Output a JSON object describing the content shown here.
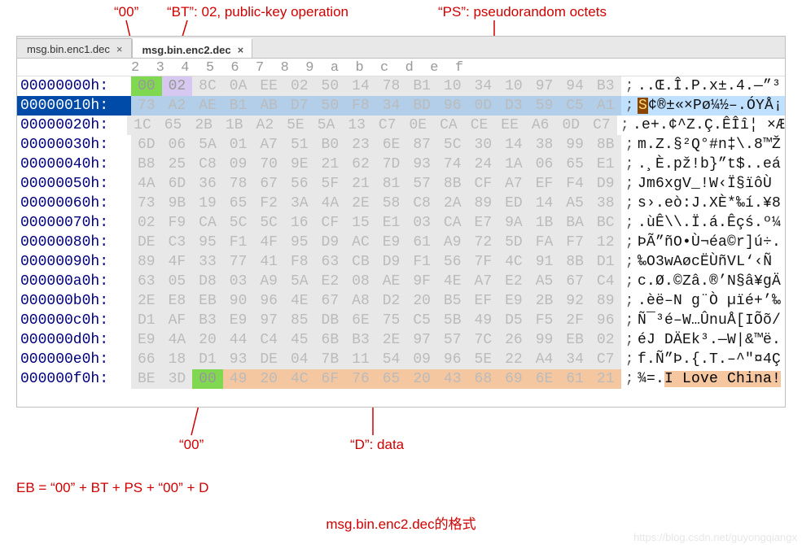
{
  "annotations": {
    "top1": "“00”",
    "top2": "“BT”: 02, public-key operation",
    "top3": "“PS”: pseudorandom octets",
    "bot1": "“00”",
    "bot2": "“D”: data",
    "formula": "EB = “00” + BT + PS + “00” + D",
    "caption": "msg.bin.enc2.dec的格式"
  },
  "tabs": {
    "inactive_label": "msg.bin.enc1.dec",
    "active_label": "msg.bin.enc2.dec",
    "close_glyph": "×"
  },
  "hex": {
    "col_header": "2  3  4  5  6  7  8  9  a  b  c  d  e  f",
    "rows": [
      {
        "off": "00000000h:",
        "bytes": [
          "00",
          "02",
          "8C",
          "0A",
          "EE",
          "02",
          "50",
          "14",
          "78",
          "B1",
          "10",
          "34",
          "10",
          "97",
          "94",
          "B3"
        ],
        "ascii": "..Œ.Î.P.x±.4.—”³",
        "styles": [
          "gr",
          "pu",
          "gy",
          "gy",
          "gy",
          "gy",
          "gy",
          "gy",
          "gy",
          "gy",
          "gy",
          "gy",
          "gy",
          "gy",
          "gy",
          "gy"
        ]
      },
      {
        "off": "00000010h:",
        "sel": true,
        "bytes": [
          "73",
          "A2",
          "AE",
          "B1",
          "AB",
          "D7",
          "50",
          "F8",
          "34",
          "BD",
          "96",
          "0D",
          "D3",
          "59",
          "C5",
          "A1"
        ],
        "ascii": [
          "S",
          "¢®±«×Pø¼½–.ÓYÅ¡"
        ],
        "styles": [
          "gy",
          "gy",
          "gy",
          "gy",
          "gy",
          "gy",
          "gy",
          "gy",
          "gy",
          "gy",
          "gy",
          "gy",
          "gy",
          "gy",
          "gy",
          "gy"
        ]
      },
      {
        "off": "00000020h:",
        "bytes": [
          "1C",
          "65",
          "2B",
          "1B",
          "A2",
          "5E",
          "5A",
          "13",
          "C7",
          "0E",
          "CA",
          "CE",
          "EE",
          "A6",
          "0D",
          "C7"
        ],
        "ascii": ".e+.¢^Z.Ç.ÊÎî¦ ×Æ",
        "styles": [
          "gy",
          "gy",
          "gy",
          "gy",
          "gy",
          "gy",
          "gy",
          "gy",
          "gy",
          "gy",
          "gy",
          "gy",
          "gy",
          "gy",
          "gy",
          "gy"
        ]
      },
      {
        "off": "00000030h:",
        "bytes": [
          "6D",
          "06",
          "5A",
          "01",
          "A7",
          "51",
          "B0",
          "23",
          "6E",
          "87",
          "5C",
          "30",
          "14",
          "38",
          "99",
          "8B"
        ],
        "ascii": "m.Z.§²Q°#n‡\\.8™Ž",
        "styles": [
          "gy",
          "gy",
          "gy",
          "gy",
          "gy",
          "gy",
          "gy",
          "gy",
          "gy",
          "gy",
          "gy",
          "gy",
          "gy",
          "gy",
          "gy",
          "gy"
        ]
      },
      {
        "off": "00000040h:",
        "bytes": [
          "B8",
          "25",
          "C8",
          "09",
          "70",
          "9E",
          "21",
          "62",
          "7D",
          "93",
          "74",
          "24",
          "1A",
          "06",
          "65",
          "E1"
        ],
        "ascii": ".¸È.pž!b}”t$..eá",
        "styles": [
          "gy",
          "gy",
          "gy",
          "gy",
          "gy",
          "gy",
          "gy",
          "gy",
          "gy",
          "gy",
          "gy",
          "gy",
          "gy",
          "gy",
          "gy",
          "gy"
        ]
      },
      {
        "off": "00000050h:",
        "bytes": [
          "4A",
          "6D",
          "36",
          "78",
          "67",
          "56",
          "5F",
          "21",
          "81",
          "57",
          "8B",
          "CF",
          "A7",
          "EF",
          "F4",
          "D9"
        ],
        "ascii": "Jm6xgV_!W‹Ï§ïôÙ",
        "styles": [
          "gy",
          "gy",
          "gy",
          "gy",
          "gy",
          "gy",
          "gy",
          "gy",
          "gy",
          "gy",
          "gy",
          "gy",
          "gy",
          "gy",
          "gy",
          "gy"
        ]
      },
      {
        "off": "00000060h:",
        "bytes": [
          "73",
          "9B",
          "19",
          "65",
          "F2",
          "3A",
          "4A",
          "2E",
          "58",
          "C8",
          "2A",
          "89",
          "ED",
          "14",
          "A5",
          "38"
        ],
        "ascii": "s›.eò:J.XÈ*‰í.¥8",
        "styles": [
          "gy",
          "gy",
          "gy",
          "gy",
          "gy",
          "gy",
          "gy",
          "gy",
          "gy",
          "gy",
          "gy",
          "gy",
          "gy",
          "gy",
          "gy",
          "gy"
        ]
      },
      {
        "off": "00000070h:",
        "bytes": [
          "02",
          "F9",
          "CA",
          "5C",
          "5C",
          "16",
          "CF",
          "15",
          "E1",
          "03",
          "CA",
          "E7",
          "9A",
          "1B",
          "BA",
          "BC"
        ],
        "ascii": ".ùÊ\\\\.Ï.á.Êçś.º¼",
        "styles": [
          "gy",
          "gy",
          "gy",
          "gy",
          "gy",
          "gy",
          "gy",
          "gy",
          "gy",
          "gy",
          "gy",
          "gy",
          "gy",
          "gy",
          "gy",
          "gy"
        ]
      },
      {
        "off": "00000080h:",
        "bytes": [
          "DE",
          "C3",
          "95",
          "F1",
          "4F",
          "95",
          "D9",
          "AC",
          "E9",
          "61",
          "A9",
          "72",
          "5D",
          "FA",
          "F7",
          "12"
        ],
        "ascii": "ÞÃ”ñO•Ù¬éa©r]ú÷.",
        "styles": [
          "gy",
          "gy",
          "gy",
          "gy",
          "gy",
          "gy",
          "gy",
          "gy",
          "gy",
          "gy",
          "gy",
          "gy",
          "gy",
          "gy",
          "gy",
          "gy"
        ]
      },
      {
        "off": "00000090h:",
        "bytes": [
          "89",
          "4F",
          "33",
          "77",
          "41",
          "F8",
          "63",
          "CB",
          "D9",
          "F1",
          "56",
          "7F",
          "4C",
          "91",
          "8B",
          "D1"
        ],
        "ascii": "‰O3wAøcËÙñVL‘‹Ñ",
        "styles": [
          "gy",
          "gy",
          "gy",
          "gy",
          "gy",
          "gy",
          "gy",
          "gy",
          "gy",
          "gy",
          "gy",
          "gy",
          "gy",
          "gy",
          "gy",
          "gy"
        ]
      },
      {
        "off": "000000a0h:",
        "bytes": [
          "63",
          "05",
          "D8",
          "03",
          "A9",
          "5A",
          "E2",
          "08",
          "AE",
          "9F",
          "4E",
          "A7",
          "E2",
          "A5",
          "67",
          "C4"
        ],
        "ascii": "c.Ø.©Zâ.®’N§â¥gÄ",
        "styles": [
          "gy",
          "gy",
          "gy",
          "gy",
          "gy",
          "gy",
          "gy",
          "gy",
          "gy",
          "gy",
          "gy",
          "gy",
          "gy",
          "gy",
          "gy",
          "gy"
        ]
      },
      {
        "off": "000000b0h:",
        "bytes": [
          "2E",
          "E8",
          "EB",
          "90",
          "96",
          "4E",
          "67",
          "A8",
          "D2",
          "20",
          "B5",
          "EF",
          "E9",
          "2B",
          "92",
          "89"
        ],
        "ascii": ".èë–N g¨Ò µïé+’‰",
        "styles": [
          "gy",
          "gy",
          "gy",
          "gy",
          "gy",
          "gy",
          "gy",
          "gy",
          "gy",
          "gy",
          "gy",
          "gy",
          "gy",
          "gy",
          "gy",
          "gy"
        ]
      },
      {
        "off": "000000c0h:",
        "bytes": [
          "D1",
          "AF",
          "B3",
          "E9",
          "97",
          "85",
          "DB",
          "6E",
          "75",
          "C5",
          "5B",
          "49",
          "D5",
          "F5",
          "2F",
          "96"
        ],
        "ascii": "Ñ¯³é–W…ÛnuÅ[IÕõ/",
        "styles": [
          "gy",
          "gy",
          "gy",
          "gy",
          "gy",
          "gy",
          "gy",
          "gy",
          "gy",
          "gy",
          "gy",
          "gy",
          "gy",
          "gy",
          "gy",
          "gy"
        ]
      },
      {
        "off": "000000d0h:",
        "bytes": [
          "E9",
          "4A",
          "20",
          "44",
          "C4",
          "45",
          "6B",
          "B3",
          "2E",
          "97",
          "57",
          "7C",
          "26",
          "99",
          "EB",
          "02"
        ],
        "ascii": "éJ DÄEk³.—W|&™ë.",
        "styles": [
          "gy",
          "gy",
          "gy",
          "gy",
          "gy",
          "gy",
          "gy",
          "gy",
          "gy",
          "gy",
          "gy",
          "gy",
          "gy",
          "gy",
          "gy",
          "gy"
        ]
      },
      {
        "off": "000000e0h:",
        "bytes": [
          "66",
          "18",
          "D1",
          "93",
          "DE",
          "04",
          "7B",
          "11",
          "54",
          "09",
          "96",
          "5E",
          "22",
          "A4",
          "34",
          "C7"
        ],
        "ascii": "f.Ñ”Þ.{.T.–^\"¤4Ç",
        "styles": [
          "gy",
          "gy",
          "gy",
          "gy",
          "gy",
          "gy",
          "gy",
          "gy",
          "gy",
          "gy",
          "gy",
          "gy",
          "gy",
          "gy",
          "gy",
          "gy"
        ]
      },
      {
        "off": "000000f0h:",
        "bytes": [
          "BE",
          "3D",
          "00",
          "49",
          "20",
          "4C",
          "6F",
          "76",
          "65",
          "20",
          "43",
          "68",
          "69",
          "6E",
          "61",
          "21"
        ],
        "ascii": [
          "¾=.",
          "I Love China!"
        ],
        "styles": [
          "gy",
          "gy",
          "gr",
          "or",
          "or",
          "or",
          "or",
          "or",
          "or",
          "or",
          "or",
          "or",
          "or",
          "or",
          "or",
          "or"
        ]
      }
    ]
  },
  "watermark": "https://blog.csdn.net/guyongqiangx"
}
